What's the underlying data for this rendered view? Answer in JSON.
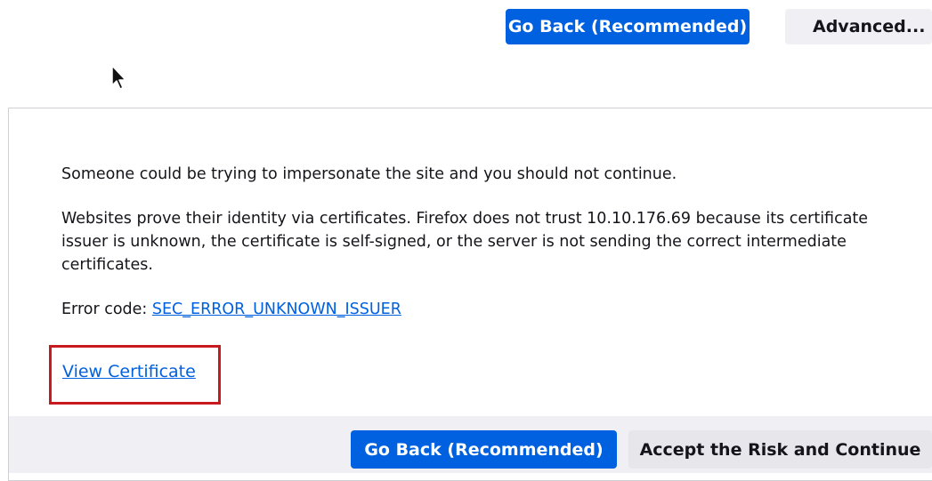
{
  "top_buttons": {
    "go_back_label": "Go Back (Recommended)",
    "advanced_label": "Advanced..."
  },
  "advanced_panel": {
    "warning_text": "Someone could be trying to impersonate the site and you should not continue.",
    "identity_text": "Websites prove their identity via certificates. Firefox does not trust 10.10.176.69 because its certificate issuer is unknown, the certificate is self-signed, or the server is not sending the correct intermediate certificates.",
    "error_code_prefix": "Error code: ",
    "error_code": "SEC_ERROR_UNKNOWN_ISSUER",
    "view_certificate_label": "View Certificate"
  },
  "bottom_buttons": {
    "go_back_label": "Go Back (Recommended)",
    "accept_label": "Accept the Risk and Continue"
  },
  "colors": {
    "primary": "#0061e0",
    "secondary": "#f0f0f4",
    "highlight": "#c8191e",
    "text": "#15141a"
  },
  "icons": {
    "cursor": "mouse-pointer-icon"
  }
}
